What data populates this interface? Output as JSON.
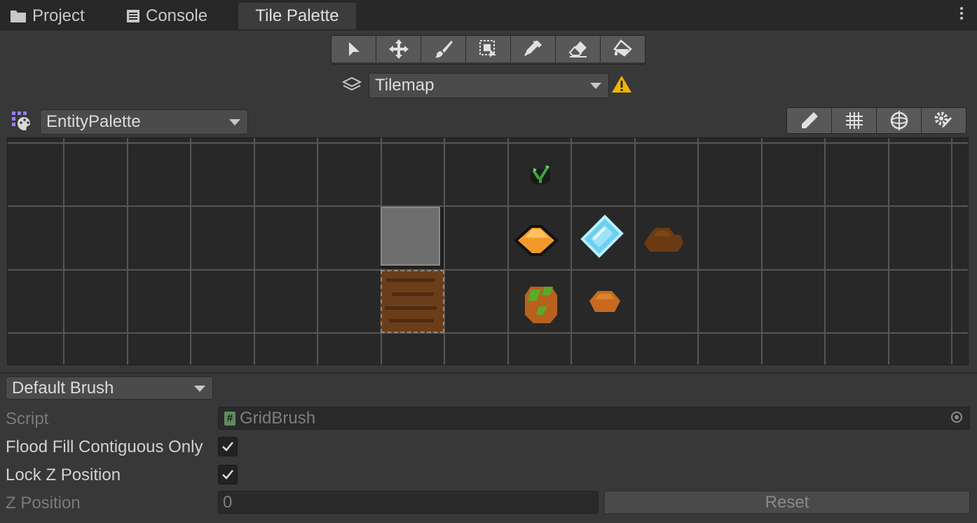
{
  "tabs": [
    {
      "label": "Project",
      "icon": "folder-icon"
    },
    {
      "label": "Console",
      "icon": "console-icon"
    },
    {
      "label": "Tile Palette",
      "icon": "",
      "active": true
    }
  ],
  "toolbar": [
    "select-tool",
    "move-tool",
    "paint-brush-tool",
    "box-fill-tool",
    "pick-tool",
    "erase-tool",
    "flood-fill-tool"
  ],
  "tilemap": {
    "selected": "Tilemap",
    "warning_icon": "warning-icon"
  },
  "palette": {
    "selected": "EntityPalette"
  },
  "palette_tools": [
    "edit-palette-icon",
    "grid-toggle-icon",
    "gizmos-icon",
    "palette-settings-icon"
  ],
  "tiles": [
    {
      "name": "sprout-tile",
      "col": 8,
      "row": 0
    },
    {
      "name": "stone-tile",
      "col": 6,
      "row": 1
    },
    {
      "name": "orange-ore-tile",
      "col": 8,
      "row": 1
    },
    {
      "name": "diamond-tile",
      "col": 9,
      "row": 1
    },
    {
      "name": "dirt-clump-tile",
      "col": 10,
      "row": 1
    },
    {
      "name": "dirt-tile",
      "col": 6,
      "row": 2
    },
    {
      "name": "mossy-rock-tile",
      "col": 8,
      "row": 2
    },
    {
      "name": "copper-nugget-tile",
      "col": 9,
      "row": 2
    }
  ],
  "brush": {
    "selected": "Default Brush",
    "script_label": "Script",
    "script_value": "GridBrush",
    "flood_fill_label": "Flood Fill Contiguous Only",
    "flood_fill_checked": true,
    "lock_z_label": "Lock Z Position",
    "lock_z_checked": true,
    "z_position_label": "Z Position",
    "z_position_value": "0",
    "reset_label": "Reset"
  },
  "colors": {
    "accent_warning": "#f0b400",
    "palette_icon": "#9a7ef0"
  }
}
